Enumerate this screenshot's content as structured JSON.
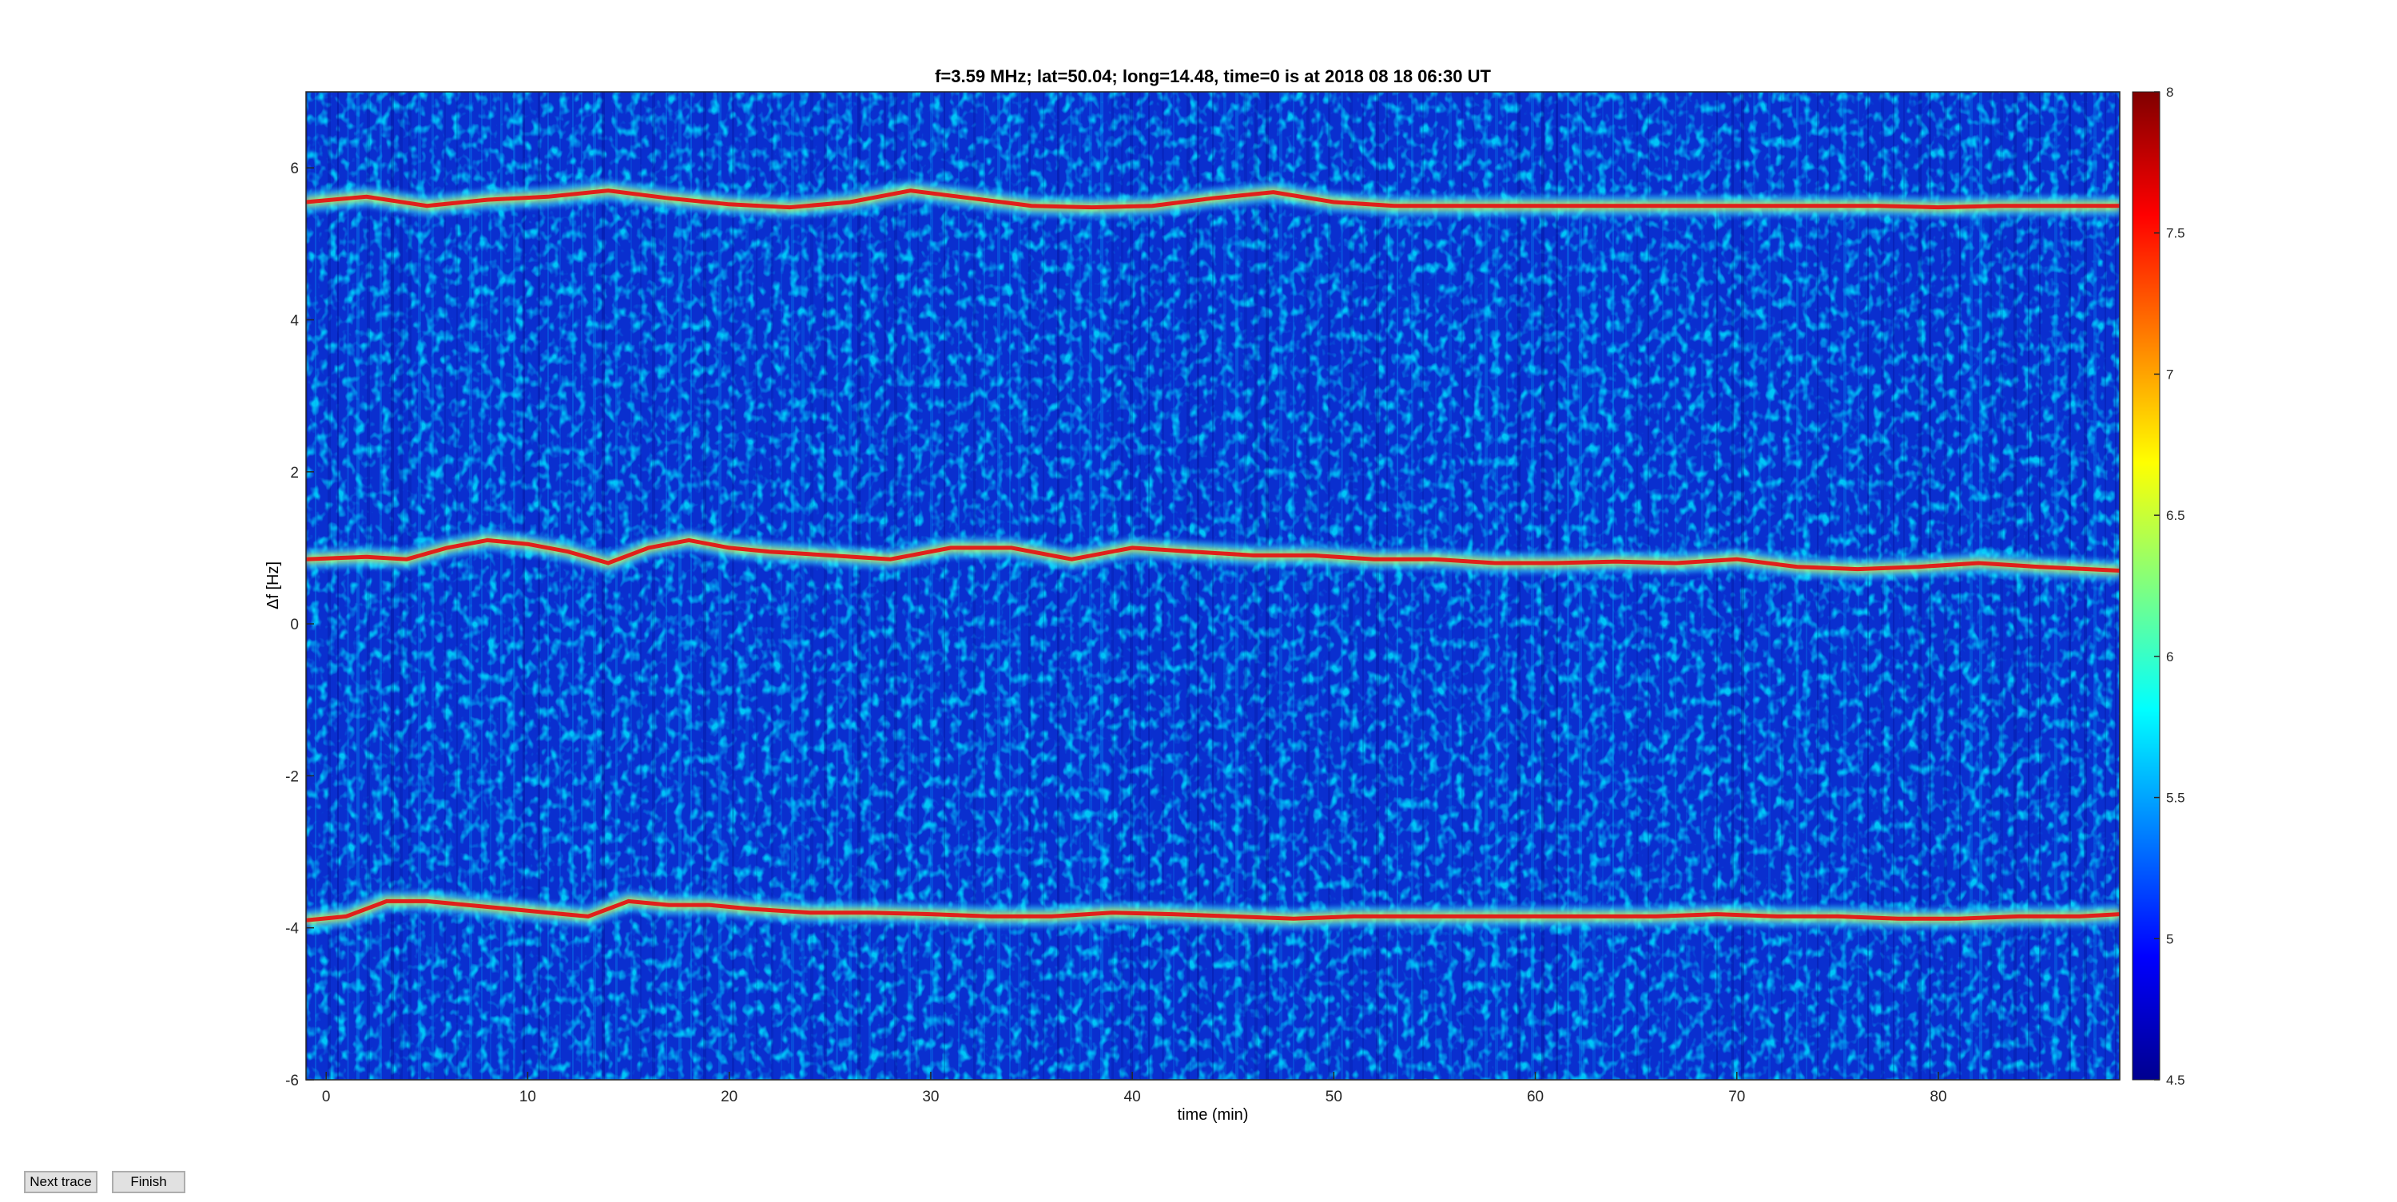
{
  "chart_data": {
    "type": "heatmap",
    "title": "f=3.59 MHz;  lat=50.04; long=14.48, time=0 is at 2018 08 18 06:30 UT",
    "xlabel": "time (min)",
    "ylabel": "Δf [Hz]",
    "xlim": [
      -1,
      89
    ],
    "ylim": [
      -6,
      7
    ],
    "xticks": [
      0,
      10,
      20,
      30,
      40,
      50,
      60,
      70,
      80
    ],
    "yticks": [
      -6,
      -4,
      -2,
      0,
      2,
      4,
      6
    ],
    "colorbar": {
      "clim": [
        4.5,
        8
      ],
      "ticks": [
        4.5,
        5,
        5.5,
        6,
        6.5,
        7,
        7.5,
        8
      ],
      "colormap": "jet"
    },
    "series": [
      {
        "x": [
          -1,
          2,
          5,
          8,
          11,
          14,
          17,
          20,
          23,
          26,
          29,
          32,
          35,
          38,
          41,
          44,
          47,
          50,
          53,
          56,
          59,
          62,
          65,
          68,
          71,
          74,
          77,
          80,
          83,
          86,
          89
        ],
        "y": [
          5.55,
          5.62,
          5.5,
          5.58,
          5.62,
          5.7,
          5.6,
          5.52,
          5.48,
          5.55,
          5.7,
          5.6,
          5.5,
          5.48,
          5.5,
          5.6,
          5.68,
          5.55,
          5.5,
          5.5,
          5.5,
          5.5,
          5.5,
          5.5,
          5.5,
          5.5,
          5.5,
          5.48,
          5.5,
          5.5,
          5.5
        ]
      },
      {
        "x": [
          -1,
          2,
          4,
          6,
          8,
          10,
          12,
          14,
          16,
          18,
          20,
          22,
          25,
          28,
          31,
          34,
          37,
          40,
          43,
          46,
          49,
          52,
          55,
          58,
          61,
          64,
          67,
          70,
          73,
          76,
          79,
          82,
          85,
          89
        ],
        "y": [
          0.85,
          0.88,
          0.85,
          1.0,
          1.1,
          1.05,
          0.95,
          0.8,
          1.0,
          1.1,
          1.0,
          0.95,
          0.9,
          0.85,
          1.0,
          1.0,
          0.85,
          1.0,
          0.95,
          0.9,
          0.9,
          0.85,
          0.85,
          0.8,
          0.8,
          0.82,
          0.8,
          0.85,
          0.75,
          0.72,
          0.75,
          0.8,
          0.75,
          0.7
        ]
      },
      {
        "x": [
          -1,
          1,
          3,
          5,
          7,
          9,
          11,
          13,
          15,
          17,
          19,
          21,
          24,
          27,
          30,
          33,
          36,
          39,
          42,
          45,
          48,
          51,
          54,
          57,
          60,
          63,
          66,
          69,
          72,
          75,
          78,
          81,
          84,
          87,
          89
        ],
        "y": [
          -3.9,
          -3.85,
          -3.65,
          -3.65,
          -3.7,
          -3.75,
          -3.8,
          -3.85,
          -3.65,
          -3.7,
          -3.7,
          -3.75,
          -3.8,
          -3.8,
          -3.82,
          -3.85,
          -3.85,
          -3.8,
          -3.82,
          -3.85,
          -3.88,
          -3.85,
          -3.85,
          -3.85,
          -3.85,
          -3.85,
          -3.85,
          -3.82,
          -3.85,
          -3.85,
          -3.88,
          -3.88,
          -3.85,
          -3.85,
          -3.82
        ]
      }
    ]
  },
  "buttons": {
    "next_label": "Next trace",
    "finish_label": "Finish"
  }
}
